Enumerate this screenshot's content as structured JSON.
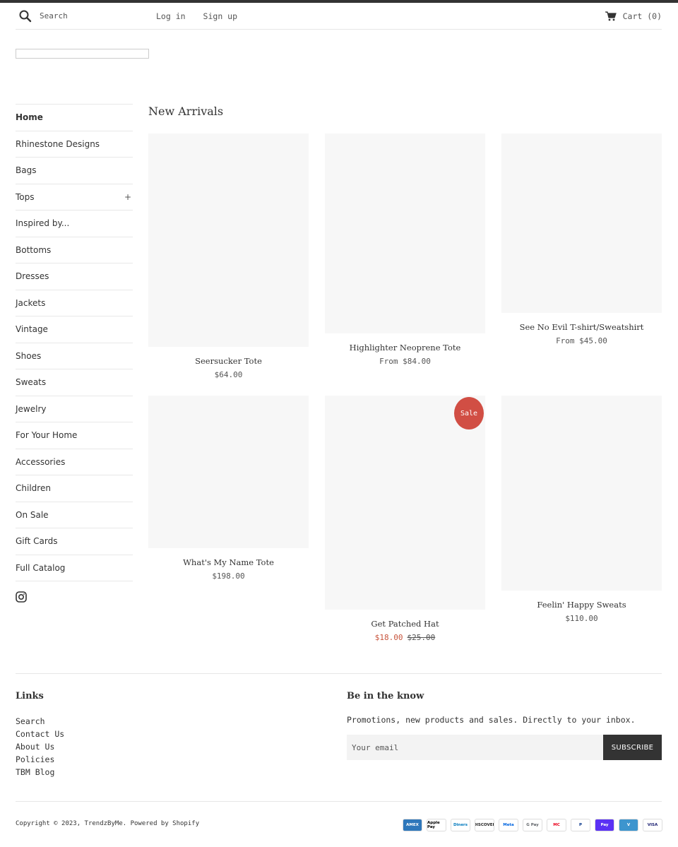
{
  "header": {
    "search_placeholder": "Search",
    "login": "Log in",
    "signup": "Sign up",
    "cart": "Cart (0)"
  },
  "sidebar": {
    "items": [
      {
        "label": "Home",
        "active": true
      },
      {
        "label": "Rhinestone Designs"
      },
      {
        "label": "Bags"
      },
      {
        "label": "Tops",
        "expandable": "+"
      },
      {
        "label": "Inspired by..."
      },
      {
        "label": "Bottoms"
      },
      {
        "label": "Dresses"
      },
      {
        "label": "Jackets"
      },
      {
        "label": "Vintage"
      },
      {
        "label": "Shoes"
      },
      {
        "label": "Sweats"
      },
      {
        "label": "Jewelry"
      },
      {
        "label": "For Your Home"
      },
      {
        "label": "Accessories"
      },
      {
        "label": "Children"
      },
      {
        "label": "On Sale"
      },
      {
        "label": "Gift Cards"
      },
      {
        "label": "Full Catalog"
      }
    ],
    "social_icon": "instagram-icon"
  },
  "main": {
    "title": "New Arrivals",
    "products": [
      {
        "name": "Seersucker Tote",
        "price": "$64.00"
      },
      {
        "name": "Highlighter Neoprene Tote",
        "price": "From $84.00"
      },
      {
        "name": "See No Evil T-shirt/Sweatshirt",
        "price": "From $45.00"
      },
      {
        "name": "What's My Name Tote",
        "price": "$198.00"
      },
      {
        "name": "Get Patched Hat",
        "sale_price": "$18.00",
        "compare_price": "$25.00",
        "badge": "Sale"
      },
      {
        "name": "Feelin' Happy Sweats",
        "price": "$110.00"
      }
    ]
  },
  "footer": {
    "links_heading": "Links",
    "links": [
      "Search",
      "Contact Us",
      "About Us",
      "Policies",
      "TBM Blog"
    ],
    "newsletter_heading": "Be in the know",
    "newsletter_text": "Promotions, new products and sales. Directly to your inbox.",
    "email_placeholder": "Your email",
    "subscribe": "SUBSCRIBE",
    "copyright_prefix": "Copyright © 2023,",
    "store_name": "TrendzByMe",
    "powered": "Powered by Shopify",
    "payments": [
      {
        "label": "AMEX",
        "bg": "#2e77bb",
        "fg": "#ffffff"
      },
      {
        "label": "Apple Pay",
        "bg": "#ffffff",
        "fg": "#000000"
      },
      {
        "label": "Diners",
        "bg": "#ffffff",
        "fg": "#0079be"
      },
      {
        "label": "DISCOVER",
        "bg": "#ffffff",
        "fg": "#222222"
      },
      {
        "label": "Meta",
        "bg": "#ffffff",
        "fg": "#0064e0"
      },
      {
        "label": "G Pay",
        "bg": "#ffffff",
        "fg": "#5f6368"
      },
      {
        "label": "MC",
        "bg": "#ffffff",
        "fg": "#eb001b"
      },
      {
        "label": "P",
        "bg": "#ffffff",
        "fg": "#003087"
      },
      {
        "label": "Pay",
        "bg": "#5a31f4",
        "fg": "#ffffff"
      },
      {
        "label": "V",
        "bg": "#3d95ce",
        "fg": "#ffffff"
      },
      {
        "label": "VISA",
        "bg": "#ffffff",
        "fg": "#1a1f71"
      }
    ]
  }
}
